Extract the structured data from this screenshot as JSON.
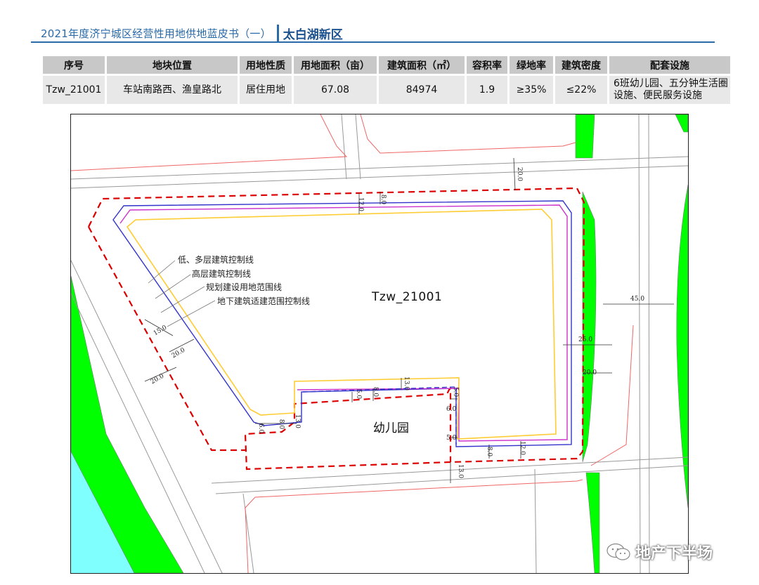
{
  "header": {
    "left_title": "2021年度济宁城区经营性用地供地蓝皮书（一）",
    "right_title": "太白湖新区"
  },
  "table": {
    "headers": [
      "序号",
      "地块位置",
      "用地性质",
      "用地面积（亩）",
      "建筑面积（㎡）",
      "容积率",
      "绿地率",
      "建筑密度",
      "配套设施"
    ],
    "row": {
      "id": "Tzw_21001",
      "location": "车站南路西、渔皇路北",
      "land_use": "居住用地",
      "land_area_mu": "67.08",
      "floor_area_m2": "84974",
      "far": "1.9",
      "green_ratio": "≥35%",
      "building_density": "≤22%",
      "facilities": "6班幼儿园、五分钟生活圈设施、便民服务设施"
    }
  },
  "map": {
    "parcel_label": "Tzw_21001",
    "kindergarten_label": "幼儿园",
    "legend": [
      "低、多层建筑控制线",
      "高层建筑控制线",
      "规划建设用地范围线",
      "地下建筑适建范围控制线"
    ],
    "dimensions": {
      "top_road": "20.0",
      "top_setback_a": "12.0",
      "top_setback_b": "8.0",
      "left_a": "15.0",
      "left_b": "20.0",
      "left_road": "20.0",
      "right_a": "25.0",
      "right_road": "45.0",
      "right_green": "20.0",
      "kg_top_a": "5.0",
      "kg_top_b": "8.0",
      "kg_top_c": "13.0",
      "kg_left_a": "6.0",
      "kg_left_b": "8.0",
      "kg_left_c": "13.0",
      "kg_right_a": "6.0",
      "kg_right_b": "5.0",
      "kg_right_c": "5.0",
      "bottom_a": "8.0",
      "bottom_b": "12.0",
      "bottom_road": "13.0"
    },
    "colors": {
      "green": "#00ff00",
      "water": "#80ffff",
      "red_dashed": "#dd0000",
      "blue_line": "#3333cc",
      "magenta_line": "#cc33cc",
      "yellow_line": "#ffcc33",
      "road_edge": "#999999",
      "property_line": "#ee6666"
    }
  },
  "watermark": {
    "text": "地产下半场",
    "icon": "wechat-icon"
  }
}
